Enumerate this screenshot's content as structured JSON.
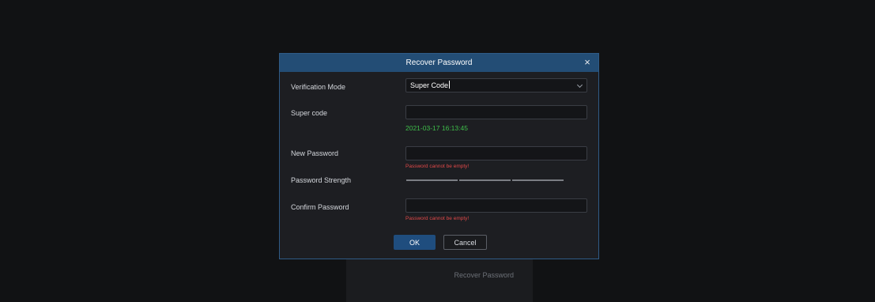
{
  "background": {
    "panel_link": "Recover Password"
  },
  "dialog": {
    "title": "Recover Password",
    "close_glyph": "×",
    "verification_mode": {
      "label": "Verification Mode",
      "value": "Super Code"
    },
    "super_code": {
      "label": "Super code",
      "value": "",
      "timestamp": "2021-03-17 16:13:45"
    },
    "new_password": {
      "label": "New Password",
      "value": "",
      "error": "Password cannot be empty!"
    },
    "password_strength": {
      "label": "Password Strength"
    },
    "confirm_password": {
      "label": "Confirm Password",
      "value": "",
      "error": "Password cannot be empty!"
    },
    "ok_label": "OK",
    "cancel_label": "Cancel"
  },
  "colors": {
    "header": "#234d75",
    "dialog_bg": "#1d1e22",
    "success_text": "#3fbf4a",
    "error_text": "#e04848",
    "primary_button": "#1f4d7e"
  }
}
